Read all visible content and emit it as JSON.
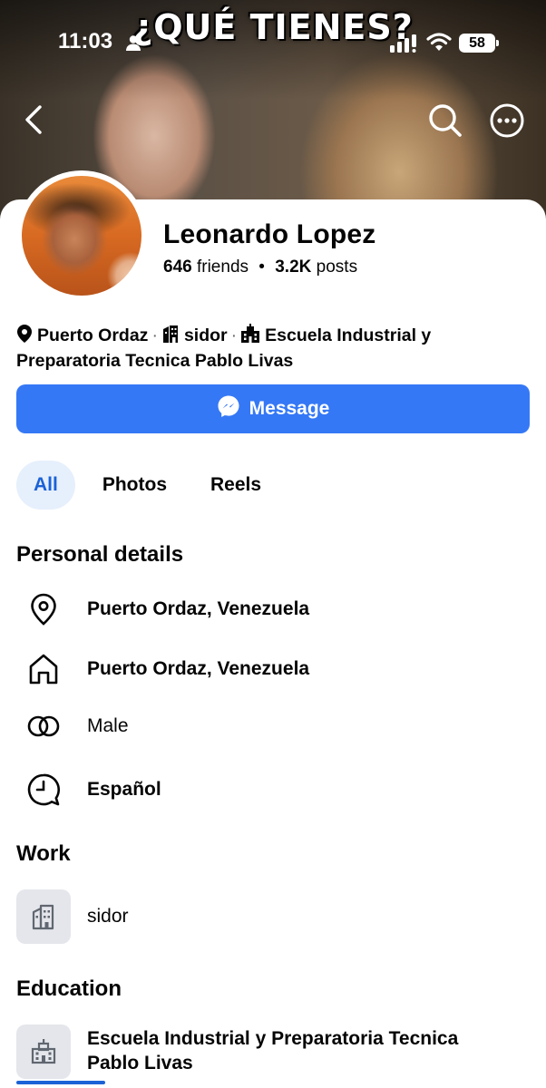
{
  "status_bar": {
    "time": "11:03",
    "battery": "58",
    "icons": [
      "person-icon",
      "signal-icon",
      "wifi-icon",
      "battery-icon"
    ]
  },
  "cover": {
    "caption": "¿QUÉ TIENES?"
  },
  "nav": {
    "icons": [
      "back-chevron-icon",
      "search-icon",
      "more-options-icon"
    ]
  },
  "profile": {
    "name": "Leonardo Lopez",
    "friends_count": "646",
    "friends_label": "friends",
    "separator": "•",
    "posts_count": "3.2K",
    "posts_label": "posts"
  },
  "intro": {
    "location": "Puerto Ordaz",
    "work": "sidor",
    "school": "Escuela Industrial y Preparatoria Tecnica Pablo Livas",
    "dot": "·"
  },
  "actions": {
    "message_label": "Message"
  },
  "tabs": [
    {
      "label": "All",
      "active": true
    },
    {
      "label": "Photos",
      "active": false
    },
    {
      "label": "Reels",
      "active": false
    }
  ],
  "personal_details": {
    "title": "Personal details",
    "items": [
      {
        "icon": "location-pin-icon",
        "text": "Puerto Ordaz, Venezuela"
      },
      {
        "icon": "home-icon",
        "text": "Puerto Ordaz, Venezuela"
      },
      {
        "icon": "gender-rings-icon",
        "text": "Male"
      },
      {
        "icon": "language-bubble-icon",
        "text": "Español"
      }
    ]
  },
  "work": {
    "title": "Work",
    "items": [
      {
        "icon": "building-icon",
        "text": "sidor"
      }
    ]
  },
  "education": {
    "title": "Education",
    "items": [
      {
        "icon": "school-icon",
        "text": "Escuela Industrial y Preparatoria Tecnica Pablo Livas"
      }
    ]
  },
  "colors": {
    "accent": "#3578f6",
    "tab_active_bg": "#e6effc",
    "tab_active_text": "#1b62d6",
    "tile_bg": "#e4e6eb"
  }
}
